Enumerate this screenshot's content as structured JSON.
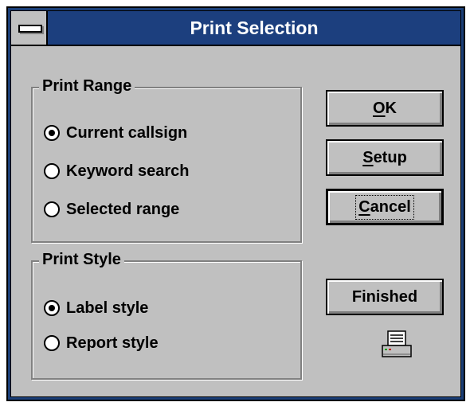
{
  "window": {
    "title": "Print Selection"
  },
  "print_range": {
    "label": "Print Range",
    "options": [
      {
        "label": "Current callsign",
        "selected": true
      },
      {
        "label": "Keyword search",
        "selected": false
      },
      {
        "label": "Selected range",
        "selected": false
      }
    ]
  },
  "print_style": {
    "label": "Print Style",
    "options": [
      {
        "label": "Label style",
        "selected": true
      },
      {
        "label": "Report style",
        "selected": false
      }
    ]
  },
  "buttons": {
    "ok": "OK",
    "setup": "Setup",
    "cancel": "Cancel",
    "finished": "Finished"
  },
  "icons": {
    "system_menu": "system-menu-icon",
    "printer": "printer-icon"
  }
}
